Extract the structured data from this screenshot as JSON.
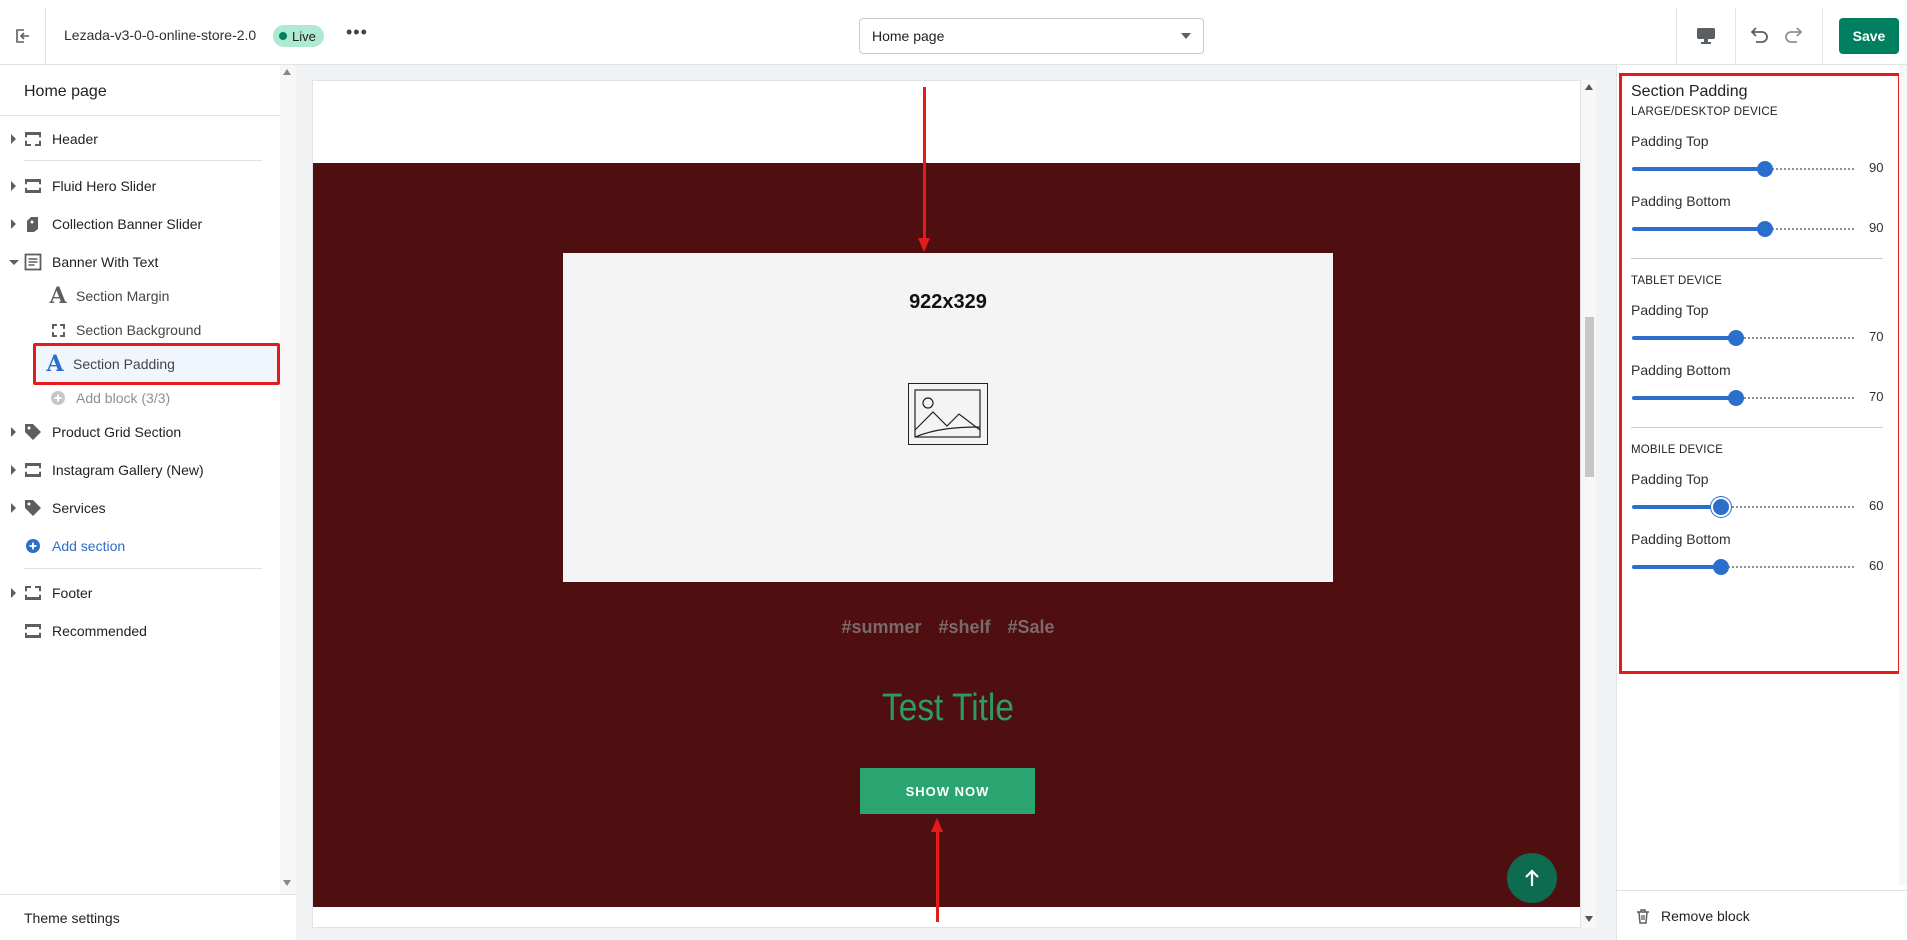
{
  "topbar": {
    "store_name": "Lezada-v3-0-0-online-store-2.0",
    "live_label": "Live",
    "more_label": "•••",
    "page_select_value": "Home page",
    "save_label": "Save"
  },
  "sidebar": {
    "title": "Home page",
    "sections": [
      {
        "label": "Header",
        "icon": "header-icon"
      },
      {
        "label": "Fluid Hero Slider",
        "icon": "slider-icon"
      },
      {
        "label": "Collection Banner Slider",
        "icon": "collection-icon"
      },
      {
        "label": "Banner With Text",
        "icon": "text-block-icon"
      }
    ],
    "blocks": [
      {
        "label": "Section Margin",
        "icon": "text-a-icon"
      },
      {
        "label": "Section Background",
        "icon": "background-icon"
      },
      {
        "label": "Section Padding",
        "icon": "text-a-icon"
      },
      {
        "label": "Add block (3/3)",
        "icon": "add-circle-icon"
      }
    ],
    "more_sections": [
      {
        "label": "Product Grid Section",
        "icon": "tag-icon"
      },
      {
        "label": "Instagram Gallery (New)",
        "icon": "slider-icon"
      },
      {
        "label": "Services",
        "icon": "tag-icon"
      }
    ],
    "add_section_label": "Add section",
    "footer_items": [
      {
        "label": "Footer",
        "icon": "footer-icon"
      },
      {
        "label": "Recommended",
        "icon": "slider-icon"
      }
    ],
    "theme_settings_label": "Theme settings"
  },
  "preview": {
    "image_size_label": "922x329",
    "tags": "#summer #shelf #Sale",
    "title": "Test Title",
    "button_label": "SHOW NOW",
    "banner_color": "#4f0e10",
    "title_color": "#2c9c62",
    "button_color": "#2aa470"
  },
  "settings_panel": {
    "title": "Section Padding",
    "groups": [
      {
        "heading": "LARGE/DESKTOP DEVICE",
        "fields": [
          {
            "label": "Padding Top",
            "value": "90",
            "level": 0.6
          },
          {
            "label": "Padding Bottom",
            "value": "90",
            "level": 0.6
          }
        ]
      },
      {
        "heading": "TABLET DEVICE",
        "fields": [
          {
            "label": "Padding Top",
            "value": "70",
            "level": 0.47
          },
          {
            "label": "Padding Bottom",
            "value": "70",
            "level": 0.47
          }
        ]
      },
      {
        "heading": "MOBILE DEVICE",
        "fields": [
          {
            "label": "Padding Top",
            "value": "60",
            "level": 0.4
          },
          {
            "label": "Padding Bottom",
            "value": "60",
            "level": 0.4
          }
        ]
      }
    ],
    "remove_label": "Remove block",
    "accent_color": "#2c6ecb"
  }
}
